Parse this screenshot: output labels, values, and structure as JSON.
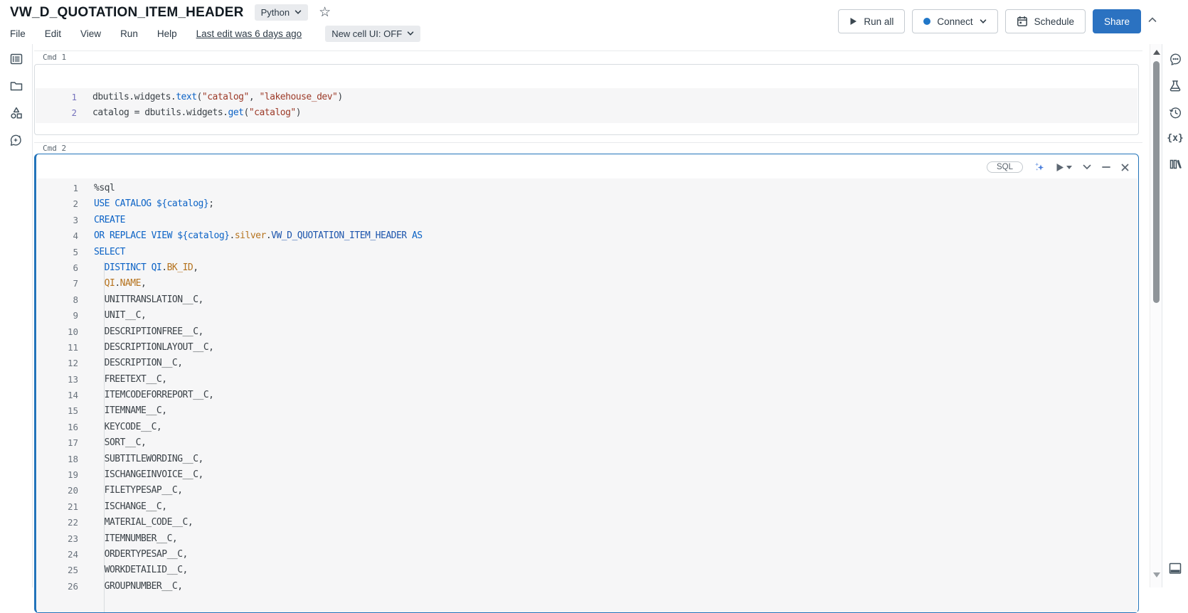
{
  "header": {
    "title": "VW_D_QUOTATION_ITEM_HEADER",
    "language": "Python",
    "star": "☆",
    "menu": [
      "File",
      "Edit",
      "View",
      "Run",
      "Help"
    ],
    "last_edit": "Last edit was 6 days ago",
    "new_cell_ui": "New cell UI: OFF",
    "actions": {
      "run_all": "Run all",
      "connect": "Connect",
      "schedule": "Schedule",
      "share": "Share"
    }
  },
  "sidebar_left": {
    "items": [
      "table-of-contents",
      "folder",
      "catalog-shapes",
      "assistant"
    ]
  },
  "sidebar_right": {
    "items": [
      "comments",
      "experiments",
      "version-history",
      "variables",
      "libraries",
      "bottom-panel"
    ],
    "variables_glyph": "{x}"
  },
  "colors": {
    "selected_cell_border": "#2374ba",
    "share_button": "#2b72c1",
    "connect_dot": "#2077c8",
    "keyword_blue": "#0c63c6",
    "identifier_orange": "#b5731e",
    "string_red": "#9c3a28",
    "code_default": "#3b4248"
  },
  "cells": [
    {
      "label": "Cmd 1",
      "language": "python",
      "lines": [
        [
          [
            "d",
            "dbutils.widgets."
          ],
          [
            "k",
            "text"
          ],
          [
            "d",
            "("
          ],
          [
            "s",
            "\"catalog\""
          ],
          [
            "d",
            ", "
          ],
          [
            "s",
            "\"lakehouse_dev\""
          ],
          [
            "d",
            ")"
          ]
        ],
        [
          [
            "d",
            "catalog = dbutils.widgets."
          ],
          [
            "k",
            "get"
          ],
          [
            "d",
            "("
          ],
          [
            "s",
            "\"catalog\""
          ],
          [
            "d",
            ")"
          ]
        ]
      ]
    },
    {
      "label": "Cmd 2",
      "language_badge": "SQL",
      "selected": true,
      "lines": [
        [
          [
            "d",
            "%sql"
          ]
        ],
        [
          [
            "k",
            "USE CATALOG"
          ],
          [
            "d",
            " "
          ],
          [
            "k",
            "${catalog}"
          ],
          [
            "d",
            ";"
          ]
        ],
        [
          [
            "k",
            "CREATE"
          ]
        ],
        [
          [
            "k",
            "OR REPLACE VIEW"
          ],
          [
            "d",
            " "
          ],
          [
            "k",
            "${catalog}"
          ],
          [
            "d",
            "."
          ],
          [
            "o",
            "silver"
          ],
          [
            "d",
            "."
          ],
          [
            "n",
            "VW_D_QUOTATION_ITEM_HEADER"
          ],
          [
            "d",
            " "
          ],
          [
            "k",
            "AS"
          ]
        ],
        [
          [
            "k",
            "SELECT"
          ]
        ],
        [
          [
            "d",
            "  "
          ],
          [
            "k",
            "DISTINCT"
          ],
          [
            "d",
            " "
          ],
          [
            "k",
            "QI"
          ],
          [
            "d",
            "."
          ],
          [
            "o",
            "BK_ID"
          ],
          [
            "d",
            ","
          ]
        ],
        [
          [
            "d",
            "  "
          ],
          [
            "o",
            "QI"
          ],
          [
            "d",
            "."
          ],
          [
            "o",
            "NAME"
          ],
          [
            "d",
            ","
          ]
        ],
        [
          [
            "d",
            "  UNITTRANSLATION__C,"
          ]
        ],
        [
          [
            "d",
            "  UNIT__C,"
          ]
        ],
        [
          [
            "d",
            "  DESCRIPTIONFREE__C,"
          ]
        ],
        [
          [
            "d",
            "  DESCRIPTIONLAYOUT__C,"
          ]
        ],
        [
          [
            "d",
            "  DESCRIPTION__C,"
          ]
        ],
        [
          [
            "d",
            "  FREETEXT__C,"
          ]
        ],
        [
          [
            "d",
            "  ITEMCODEFORREPORT__C,"
          ]
        ],
        [
          [
            "d",
            "  ITEMNAME__C,"
          ]
        ],
        [
          [
            "d",
            "  KEYCODE__C,"
          ]
        ],
        [
          [
            "d",
            "  SORT__C,"
          ]
        ],
        [
          [
            "d",
            "  SUBTITLEWORDING__C,"
          ]
        ],
        [
          [
            "d",
            "  ISCHANGEINVOICE__C,"
          ]
        ],
        [
          [
            "d",
            "  FILETYPESAP__C,"
          ]
        ],
        [
          [
            "d",
            "  ISCHANGE__C,"
          ]
        ],
        [
          [
            "d",
            "  MATERIAL_CODE__C,"
          ]
        ],
        [
          [
            "d",
            "  ITEMNUMBER__C,"
          ]
        ],
        [
          [
            "d",
            "  ORDERTYPESAP__C,"
          ]
        ],
        [
          [
            "d",
            "  WORKDETAILID__C,"
          ]
        ],
        [
          [
            "d",
            "  GROUPNUMBER__C,"
          ]
        ]
      ]
    }
  ]
}
